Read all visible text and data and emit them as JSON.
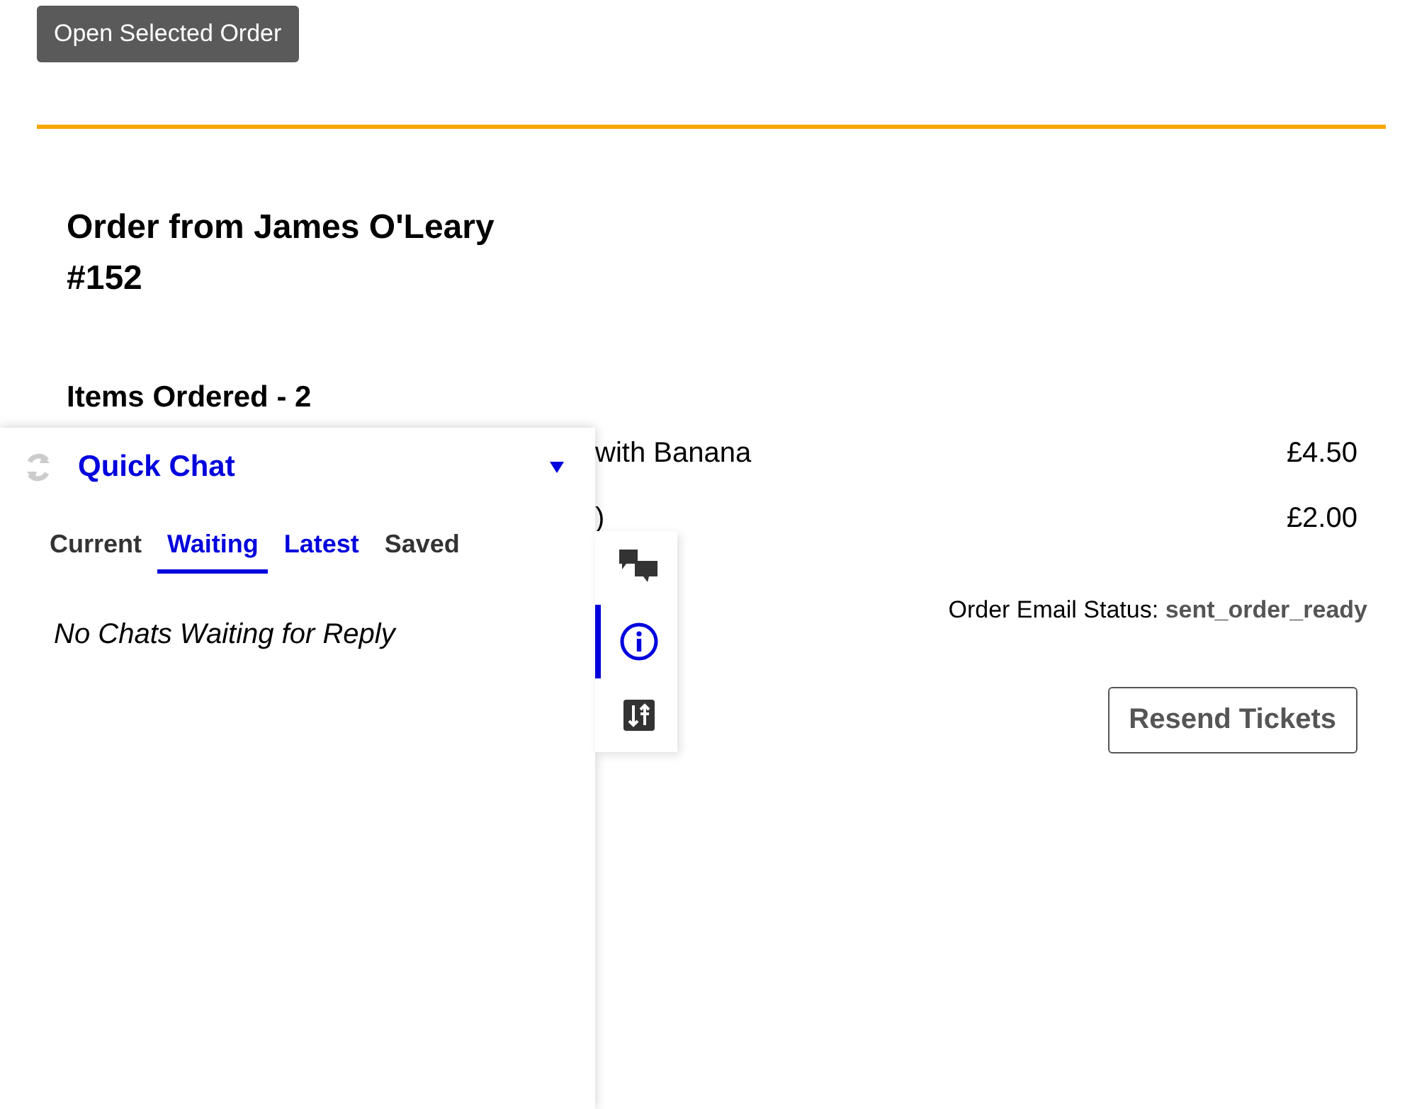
{
  "open_button": "Open Selected Order",
  "order": {
    "title": "Order from James O'Leary",
    "number": "#152",
    "items_heading": "Items Ordered - 2",
    "items": [
      {
        "name": "with Banana",
        "price": "£4.50"
      },
      {
        "name": ")",
        "price": "£2.00"
      }
    ],
    "email_status_label": "Order Email Status:",
    "email_status": "sent_order_ready",
    "resend_button": "Resend Tickets"
  },
  "quick_chat": {
    "title": "Quick Chat",
    "tabs": [
      {
        "label": "Current",
        "selected": false,
        "color": "#333333"
      },
      {
        "label": "Waiting",
        "selected": true,
        "color": "#0000dd"
      },
      {
        "label": "Latest",
        "selected": false,
        "color": "#0000dd"
      },
      {
        "label": "Saved",
        "selected": false,
        "color": "#333333"
      }
    ],
    "empty_message": "No Chats Waiting for Reply"
  },
  "side_rail": [
    {
      "kind": "chats",
      "selected": false
    },
    {
      "kind": "info",
      "selected": true
    },
    {
      "kind": "sliders",
      "selected": false
    }
  ]
}
